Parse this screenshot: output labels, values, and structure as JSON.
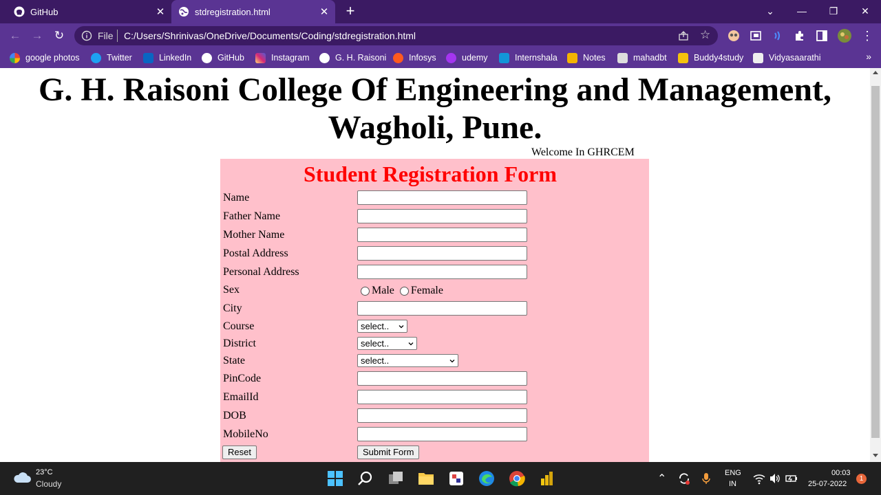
{
  "tabs": [
    {
      "title": "GitHub",
      "active": false
    },
    {
      "title": "stdregistration.html",
      "active": true
    }
  ],
  "address": {
    "scheme": "File",
    "url": "C:/Users/Shrinivas/OneDrive/Documents/Coding/stdregistration.html"
  },
  "bookmarks": [
    {
      "label": "google photos",
      "icon": "google-photos-icon",
      "color": "#34a853"
    },
    {
      "label": "Twitter",
      "icon": "twitter-icon",
      "color": "#1da1f2"
    },
    {
      "label": "LinkedIn",
      "icon": "linkedin-icon",
      "color": "#0a66c2"
    },
    {
      "label": "GitHub",
      "icon": "github-icon",
      "color": "#ffffff"
    },
    {
      "label": "Instagram",
      "icon": "instagram-icon",
      "color": "#e1306c"
    },
    {
      "label": "G. H. Raisoni",
      "icon": "globe-icon",
      "color": "#ffffff"
    },
    {
      "label": "Infosys",
      "icon": "infosys-icon",
      "color": "#ff5a1f"
    },
    {
      "label": "udemy",
      "icon": "udemy-icon",
      "color": "#a435f0"
    },
    {
      "label": "Internshala",
      "icon": "internshala-icon",
      "color": "#1295d8"
    },
    {
      "label": "Notes",
      "icon": "notes-icon",
      "color": "#f4b400"
    },
    {
      "label": "mahadbt",
      "icon": "document-icon",
      "color": "#dddddd"
    },
    {
      "label": "Buddy4study",
      "icon": "graduation-cap-icon",
      "color": "#f4c20d"
    },
    {
      "label": "Vidyasaarathi",
      "icon": "vidyasaarathi-icon",
      "color": "#eeeeee"
    }
  ],
  "page": {
    "college_title": "G. H. Raisoni College Of Engineering and Management, Wagholi, Pune.",
    "welcome": "Welcome In GHRCEM",
    "form_title": "Student Registration Form",
    "labels": {
      "name": "Name",
      "father_name": "Father Name",
      "mother_name": "Mother Name",
      "postal_address": "Postal Address",
      "personal_address": "Personal Address",
      "sex": "Sex",
      "city": "City",
      "course": "Course",
      "district": "District",
      "state": "State",
      "pincode": "PinCode",
      "email": "EmailId",
      "dob": "DOB",
      "mobile": "MobileNo"
    },
    "sex_options": {
      "male": "Male",
      "female": "Female"
    },
    "course_selected": "select..",
    "district_selected": "select..",
    "state_selected": "select..",
    "reset_label": "Reset",
    "submit_label": "Submit Form"
  },
  "taskbar": {
    "temperature": "23°C",
    "weather": "Cloudy",
    "language_1": "ENG",
    "language_2": "IN",
    "time": "00:03",
    "date": "25-07-2022",
    "notification_count": "1"
  },
  "colors": {
    "accent": "#5a3493",
    "form_bg": "#ffc0cb",
    "form_title": "#ff0000"
  }
}
